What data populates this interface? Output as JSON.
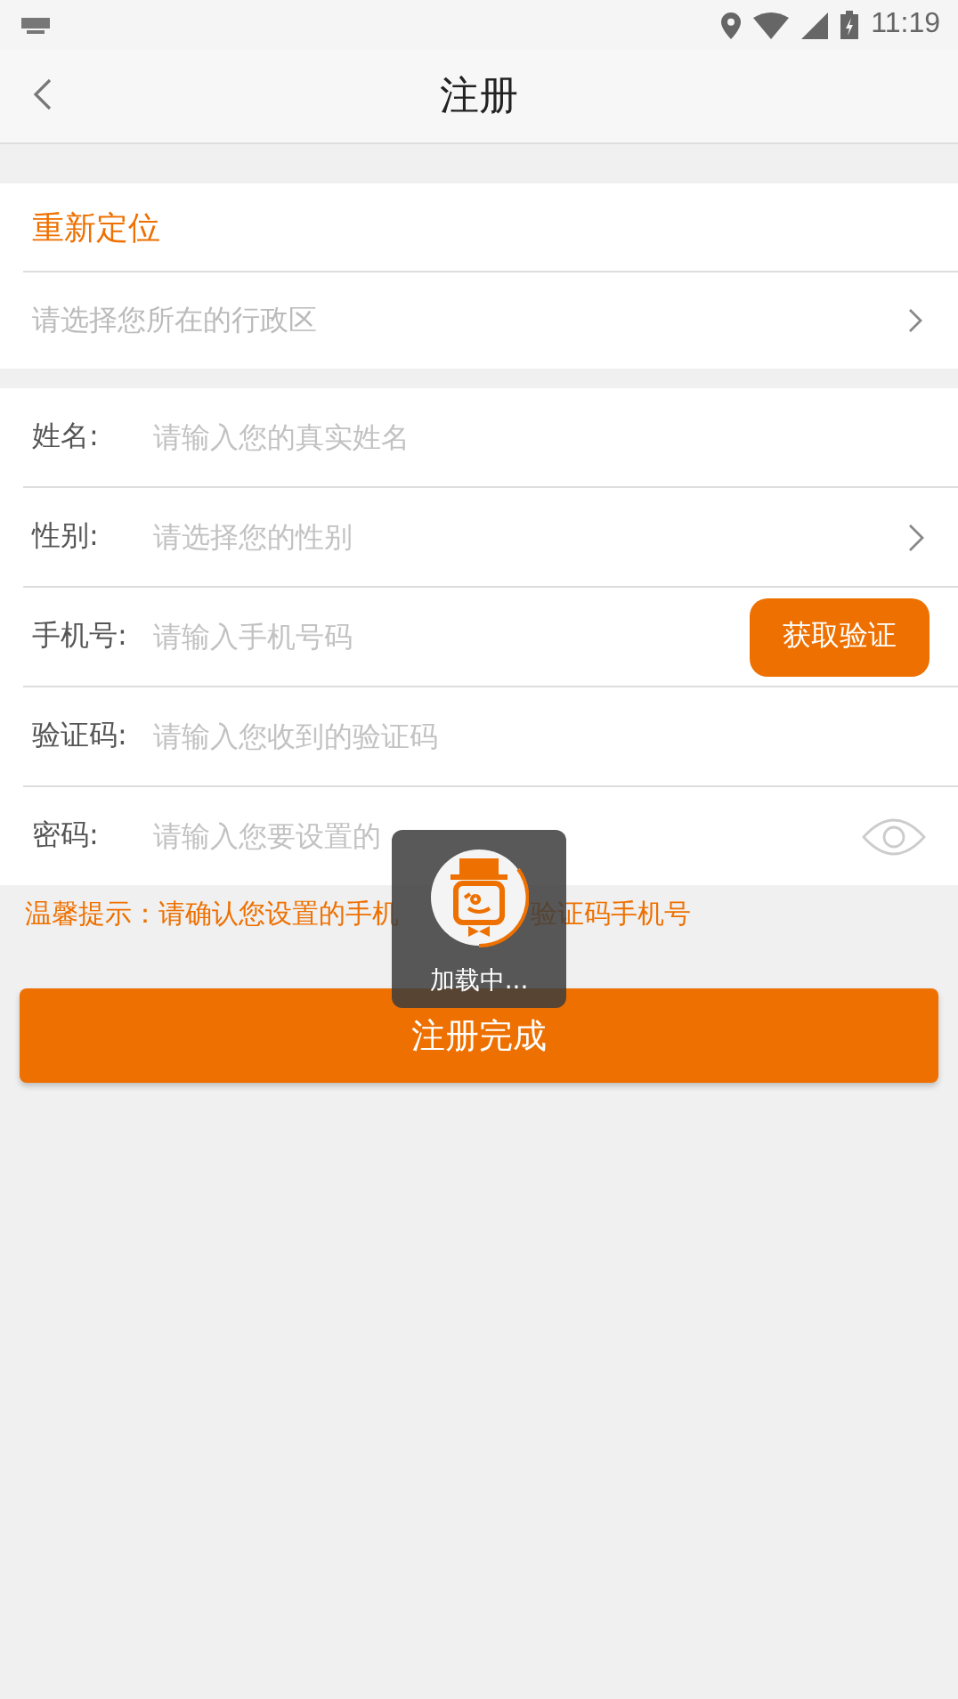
{
  "status_bar": {
    "time": "11:19"
  },
  "header": {
    "title": "注册"
  },
  "location": {
    "title": "重新定位",
    "placeholder": "请选择您所在的行政区"
  },
  "fields": [
    {
      "kind": "text",
      "label": "姓名:",
      "placeholder": "请输入您的真实姓名"
    },
    {
      "kind": "select",
      "label": "性别:",
      "placeholder": "请选择您的性别"
    },
    {
      "kind": "phone",
      "label": "手机号:",
      "placeholder": "请输入手机号码",
      "button": "获取验证"
    },
    {
      "kind": "text",
      "label": "验证码:",
      "placeholder": "请输入您收到的验证码"
    },
    {
      "kind": "password",
      "label": "密码:",
      "placeholder": "请输入您要设置的"
    }
  ],
  "hint": [
    "温馨提示：请确认您设置的手机",
    "验证码手机号"
  ],
  "submit": "注册完成",
  "loading": {
    "text": "加载中..."
  }
}
